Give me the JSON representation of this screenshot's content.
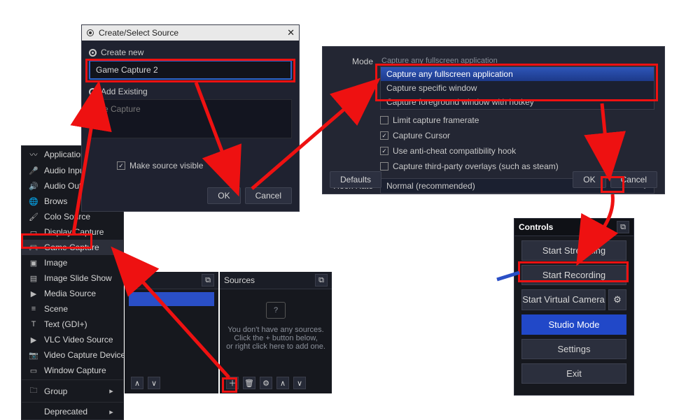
{
  "dialog": {
    "title": "Create/Select Source",
    "createNew": "Create new",
    "nameValue": "Game Capture 2",
    "addExisting": "Add Existing",
    "existing": "me Capture",
    "makeVisible": "Make source visible",
    "ok": "OK",
    "cancel": "Cancel"
  },
  "menu": {
    "items": [
      "Application Audi",
      "Audio Input Cap",
      "Audio Output Ca",
      "Brows",
      "Colo  Source",
      "Display Capture",
      "Game Capture",
      "Image",
      "Image Slide Show",
      "Media Source",
      "Scene",
      "Text (GDI+)",
      "VLC Video Source",
      "Video Capture Device",
      "Window Capture"
    ],
    "group": "Group",
    "deprecated": "Deprecated"
  },
  "sources": {
    "title": "Sources",
    "empty1": "You don't have any sources.",
    "empty2": "Click the + button below,",
    "empty3": "or right click here to add one."
  },
  "props": {
    "modeLabel": "Mode",
    "modeSel": "Capture any fullscreen application",
    "opts": [
      "Capture any fullscreen application",
      "Capture specific window",
      "Capture foreground window with hotkey"
    ],
    "limitFramerate": "Limit capture framerate",
    "captureCursor": "Capture Cursor",
    "antiCheat": "Use anti-cheat compatibility hook",
    "thirdParty": "Capture third-party overlays (such as steam)",
    "hookRateLabel": "Hook Rate",
    "hookRate": "Normal (recommended)",
    "defaults": "Defaults",
    "ok": "OK",
    "cancel": "Cancel"
  },
  "controls": {
    "title": "Controls",
    "startStreaming": "Start Streaming",
    "startRecording": "Start Recording",
    "startVirtual": "Start Virtual Camera",
    "studio": "Studio Mode",
    "settings": "Settings",
    "exit": "Exit"
  }
}
